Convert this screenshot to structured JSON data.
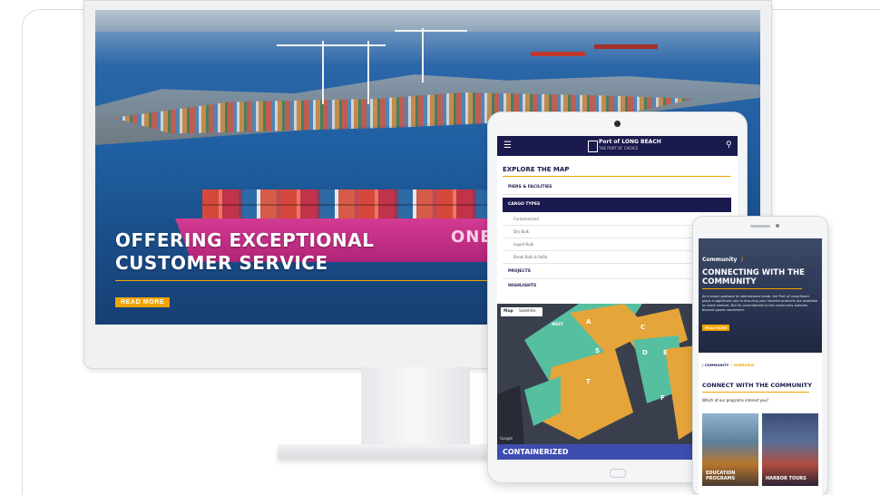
{
  "desktop": {
    "headline_line1": "OFFERING EXCEPTIONAL",
    "headline_line2": "CUSTOMER SERVICE",
    "read_more": "READ MORE",
    "ship_brand": "ONE"
  },
  "tablet": {
    "logo_text": "Port of LONG BEACH",
    "logo_sub": "THE PORT OF CHOICE",
    "menu_icon": "hamburger-icon",
    "search_icon": "search-icon",
    "title": "EXPLORE THE MAP",
    "items": [
      "PIERS & FACILITIES",
      "CARGO TYPES",
      "PROJECTS",
      "HIGHLIGHTS"
    ],
    "sub_items": [
      "Containerized",
      "Dry Bulk",
      "Liquid Bulk",
      "Break Bulk & RoRo"
    ],
    "map_tabs": [
      "Map",
      "Satellite"
    ],
    "map_zones": [
      "A",
      "C",
      "S",
      "D",
      "E",
      "T",
      "F"
    ],
    "map_label_west": "WEST",
    "map_watermark": "Google",
    "bottom_label": "CONTAINERIZED"
  },
  "phone": {
    "crumb_top": "Community",
    "crumb_top_slash": "/",
    "headline": "CONNECTING WITH THE COMMUNITY",
    "body": "As a major gateway to international trade, the Port of Long Beach plays a significant role in ensuring your favorite products are available on store shelves. But its commitment to the community extends beyond goods movement.",
    "read_more": "READ MORE",
    "breadcrumb_a": "/ COMMUNITY",
    "breadcrumb_b": "/ OVERVIEW",
    "section_title": "CONNECT WITH THE COMMUNITY",
    "question": "Which of our programs interest you?",
    "cards": [
      "EDUCATION PROGRAMS",
      "HARBOR TOURS"
    ]
  },
  "colors": {
    "navy": "#1b1a4e",
    "accent": "#f1a400",
    "ship_pink": "#c12a82"
  }
}
